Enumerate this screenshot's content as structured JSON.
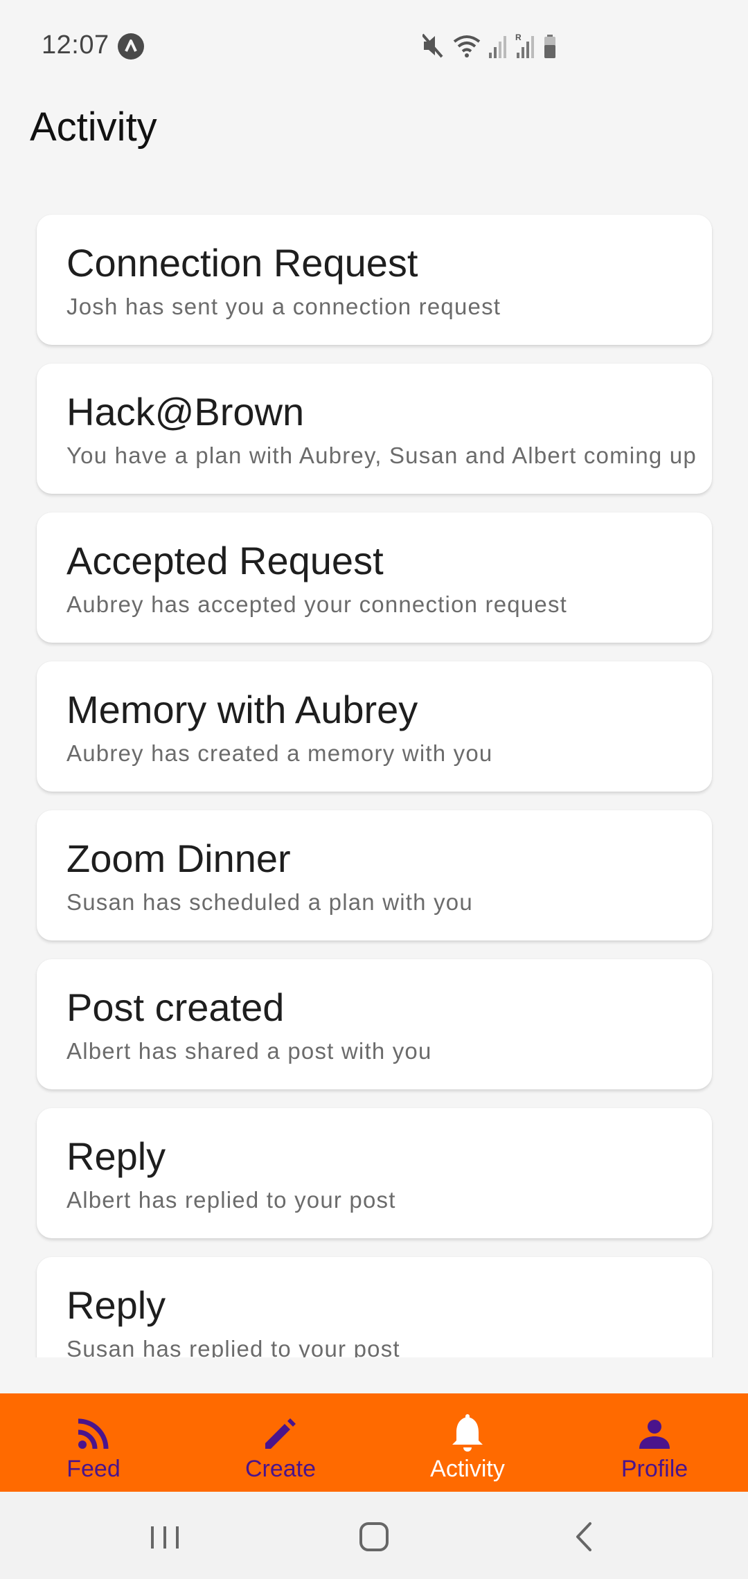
{
  "status_bar": {
    "time": "12:07",
    "icons": [
      "app-notification-icon",
      "mute-icon",
      "wifi-icon",
      "signal-icon",
      "signal-roaming-icon",
      "battery-icon"
    ]
  },
  "page": {
    "title": "Activity"
  },
  "notifications": [
    {
      "title": "Connection Request",
      "subtitle": "Josh has sent you a connection request"
    },
    {
      "title": "Hack@Brown",
      "subtitle": "You have a plan with Aubrey, Susan and Albert coming up"
    },
    {
      "title": "Accepted Request",
      "subtitle": "Aubrey has accepted your connection request"
    },
    {
      "title": "Memory with Aubrey",
      "subtitle": "Aubrey has created a memory with you"
    },
    {
      "title": "Zoom Dinner",
      "subtitle": "Susan has scheduled a plan with you"
    },
    {
      "title": "Post created",
      "subtitle": "Albert has shared a post with you"
    },
    {
      "title": "Reply",
      "subtitle": "Albert has replied to your post"
    },
    {
      "title": "Reply",
      "subtitle": "Susan has replied to your post"
    }
  ],
  "bottom_nav": {
    "items": [
      {
        "label": "Feed",
        "icon": "rss-feed-icon"
      },
      {
        "label": "Create",
        "icon": "pencil-icon"
      },
      {
        "label": "Activity",
        "icon": "bell-icon"
      },
      {
        "label": "Profile",
        "icon": "person-icon"
      }
    ],
    "active_index": 2
  },
  "colors": {
    "nav_background": "#ff6a00",
    "nav_inactive": "#4a148c",
    "nav_active": "#ffffff",
    "page_background": "#f5f5f5"
  },
  "system_nav": {
    "buttons": [
      "recent-apps-icon",
      "home-icon",
      "back-icon"
    ]
  }
}
